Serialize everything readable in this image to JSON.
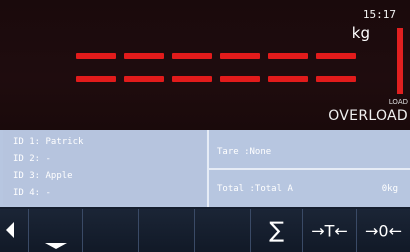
{
  "status": {
    "time": "15:17",
    "unit": "kg",
    "load_label": "LOAD",
    "overload_label": "OVERLOAD",
    "load_level": 1.0
  },
  "weight": {
    "segments": 6,
    "rows": 2,
    "color": "#e21b1b"
  },
  "ids": [
    {
      "text": "ID 1: Patrick"
    },
    {
      "text": "ID 2: -"
    },
    {
      "text": "ID 3: Apple"
    },
    {
      "text": "ID 4: -"
    }
  ],
  "tare": {
    "text": "Tare :None"
  },
  "total": {
    "label": "Total :Total A",
    "value": "0kg"
  },
  "buttons": {
    "sigma": "∑",
    "tare": "→T←",
    "zero": "→0←"
  },
  "colors": {
    "display_bg": "#1f0c0e",
    "info_bg": "#b7c6e0",
    "button_bg": "#151e2e",
    "accent_red": "#e21b1b"
  }
}
